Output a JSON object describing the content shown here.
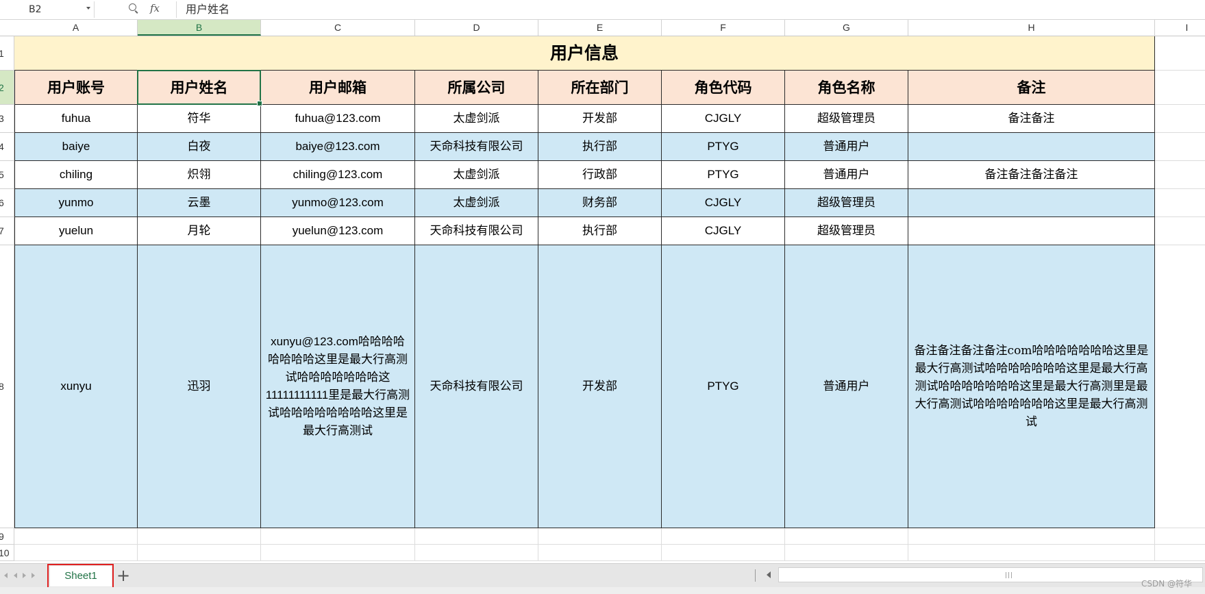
{
  "formula_bar": {
    "cell_ref": "B2",
    "fx": "fx",
    "content": "用户姓名"
  },
  "columns": [
    "A",
    "B",
    "C",
    "D",
    "E",
    "F",
    "G",
    "H",
    "I"
  ],
  "rows": [
    "1",
    "2",
    "3",
    "4",
    "5",
    "6",
    "7",
    "8",
    "9",
    "10"
  ],
  "table": {
    "title": "用户信息",
    "headers": [
      "用户账号",
      "用户姓名",
      "用户邮箱",
      "所属公司",
      "所在部门",
      "角色代码",
      "角色名称",
      "备注"
    ],
    "records": [
      [
        "fuhua",
        "符华",
        "fuhua@123.com",
        "太虚剑派",
        "开发部",
        "CJGLY",
        "超级管理员",
        "备注备注"
      ],
      [
        "baiye",
        "白夜",
        "baiye@123.com",
        "天命科技有限公司",
        "执行部",
        "PTYG",
        "普通用户",
        ""
      ],
      [
        "chiling",
        "炽翎",
        "chiling@123.com",
        "太虚剑派",
        "行政部",
        "PTYG",
        "普通用户",
        "备注备注备注备注"
      ],
      [
        "yunmo",
        "云墨",
        "yunmo@123.com",
        "太虚剑派",
        "财务部",
        "CJGLY",
        "超级管理员",
        ""
      ],
      [
        "yuelun",
        "月轮",
        "yuelun@123.com",
        "天命科技有限公司",
        "执行部",
        "CJGLY",
        "超级管理员",
        ""
      ],
      [
        "xunyu",
        "迅羽",
        "xunyu@123.com哈哈哈哈哈哈哈哈这里是最大行高测试哈哈哈哈哈哈哈这11111111111里是最大行高测试哈哈哈哈哈哈哈哈这里是最大行高测试",
        "天命科技有限公司",
        "开发部",
        "PTYG",
        "普通用户",
        "备注备注备注备注com哈哈哈哈哈哈哈这里是最大行高测试哈哈哈哈哈哈哈这里是最大行高测试哈哈哈哈哈哈哈这里是最大行高测里是最大行高测试哈哈哈哈哈哈哈这里是最大行高测试"
      ]
    ]
  },
  "sheet_tabs": [
    "Sheet1"
  ],
  "add_sheet_label": "+",
  "scroll_grip": "|||",
  "watermark": "CSDN @符华",
  "colors": {
    "title_fill": "#fff3cc",
    "header_fill": "#fce4d4",
    "band_fill": "#cfe8f5",
    "selection": "#217346",
    "tab_highlight": "#e02020"
  }
}
